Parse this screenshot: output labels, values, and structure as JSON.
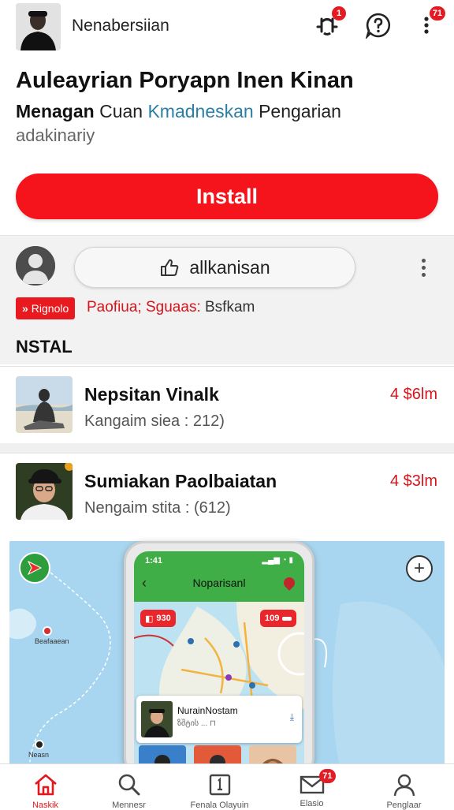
{
  "header": {
    "app_name": "Nenabersiian",
    "notification_badge": "1",
    "more_badge": "71"
  },
  "listing": {
    "title": "Auleayrian Poryapn Inen Kinan",
    "subtitle_bold": "Menagan",
    "subtitle_plain": " Cuan ",
    "subtitle_link": "Kmadneskan",
    "subtitle_rest": " Pengarian",
    "subtitle_line2": "adakinariy",
    "install_label": "Install"
  },
  "comment_panel": {
    "input_text": "allkanisan",
    "tag_label": "Rignolo",
    "tag_text_red": "Paofiua; Sguaas:",
    "tag_text_gray": " Bsfkam",
    "section_label": "NSTAL"
  },
  "rows": [
    {
      "title": "Nepsitan Vinalk",
      "subtitle": "Kangaim siea :  212)",
      "price": "4 $6lm"
    },
    {
      "title": "Sumiakan Paolbaiatan",
      "subtitle": "Nengaim stita :  (612)",
      "price": "4 $3lm"
    }
  ],
  "map": {
    "pin_labels": [
      "Beafaaean",
      "Neasn"
    ]
  },
  "phone": {
    "time": "1:41",
    "status": "▂▄▆ ◔ ▮",
    "title": "Noparisanl",
    "chip_left": "930",
    "chip_right": "109",
    "card_title": "NurainNostam",
    "card_subtitle": "ზშტის ... ⊓"
  },
  "bottom_nav": {
    "items": [
      {
        "label": "Naskik",
        "icon": "home-icon"
      },
      {
        "label": "Mennesr",
        "icon": "search-icon"
      },
      {
        "label": "Fenala Olayuin",
        "icon": "card-icon"
      },
      {
        "label": "Elasio",
        "icon": "mail-icon"
      },
      {
        "label": "Penglaar",
        "icon": "profile-icon"
      }
    ],
    "mail_badge": "71"
  },
  "colors": {
    "accent": "#f5141b",
    "link": "#2b7fa6",
    "map_water": "#a8d5ef",
    "phone_bar": "#3fae46"
  }
}
